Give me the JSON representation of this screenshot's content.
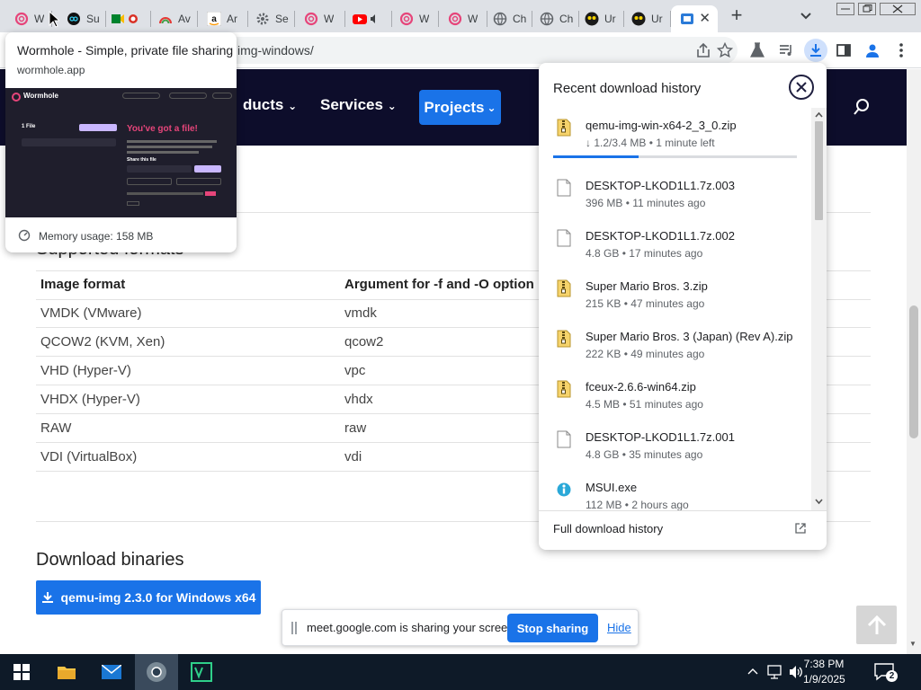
{
  "tabs": [
    {
      "title": "W",
      "icon": "wormhole-icon"
    },
    {
      "title": "Su",
      "icon": "app-icon"
    },
    {
      "title": "",
      "icon": "meet-icon"
    },
    {
      "title": "Av",
      "icon": "rainbow-icon"
    },
    {
      "title": "Ar",
      "icon": "amazon-icon"
    },
    {
      "title": "Se",
      "icon": "gear-icon"
    },
    {
      "title": "W",
      "icon": "wormhole-icon"
    },
    {
      "title": "",
      "icon": "youtube-icon"
    },
    {
      "title": "W",
      "icon": "wormhole-icon"
    },
    {
      "title": "W",
      "icon": "wormhole-icon"
    },
    {
      "title": "Ch",
      "icon": "globe-icon"
    },
    {
      "title": "Ch",
      "icon": "globe-icon"
    },
    {
      "title": "Ur",
      "icon": "owl-icon"
    },
    {
      "title": "Ur",
      "icon": "owl-icon"
    }
  ],
  "active_tab": {
    "icon": "qemu-icon",
    "close": "✕"
  },
  "new_tab": "+",
  "address": {
    "text": "img-windows/"
  },
  "site_nav": {
    "products": "ducts",
    "services": "Services",
    "projects": "Projects"
  },
  "page": {
    "formats_heading": "Supported formats",
    "table": {
      "headers": [
        "Image format",
        "Argument for -f and -O option"
      ],
      "rows": [
        [
          "VMDK (VMware)",
          "vmdk"
        ],
        [
          "QCOW2 (KVM, Xen)",
          "qcow2"
        ],
        [
          "VHD (Hyper-V)",
          "vpc"
        ],
        [
          "VHDX (Hyper-V)",
          "vhdx"
        ],
        [
          "RAW",
          "raw"
        ],
        [
          "VDI (VirtualBox)",
          "vdi"
        ]
      ]
    },
    "download_heading": "Download binaries",
    "download_button": "qemu-img 2.3.0 for Windows x64"
  },
  "hover_card": {
    "title": "Wormhole - Simple, private file sharing",
    "domain": "wormhole.app",
    "memory": "Memory usage: 158 MB",
    "preview": {
      "brand": "Wormhole",
      "headline": "You've got a file!",
      "files": "1 File",
      "share": "Share this file"
    }
  },
  "downloads": {
    "title": "Recent download history",
    "items": [
      {
        "name": "qemu-img-win-x64-2_3_0.zip",
        "meta": "↓ 1.2/3.4 MB • 1 minute left",
        "kind": "zip",
        "progress": 0.35
      },
      {
        "name": "DESKTOP-LKOD1L1.7z.003",
        "meta": "396 MB • 11 minutes ago",
        "kind": "file"
      },
      {
        "name": "DESKTOP-LKOD1L1.7z.002",
        "meta": "4.8 GB • 17 minutes ago",
        "kind": "file"
      },
      {
        "name": "Super Mario Bros. 3.zip",
        "meta": "215 KB • 47 minutes ago",
        "kind": "zip"
      },
      {
        "name": "Super Mario Bros. 3 (Japan) (Rev A).zip",
        "meta": "222 KB • 49 minutes ago",
        "kind": "zip"
      },
      {
        "name": "fceux-2.6.6-win64.zip",
        "meta": "4.5 MB • 51 minutes ago",
        "kind": "zip"
      },
      {
        "name": "DESKTOP-LKOD1L1.7z.001",
        "meta": "4.8 GB • 35 minutes ago",
        "kind": "file"
      },
      {
        "name": "MSUI.exe",
        "meta": "112 MB • 2 hours ago",
        "kind": "exe"
      }
    ],
    "footer": "Full download history"
  },
  "share_bar": {
    "text": "meet.google.com is sharing your screen.",
    "stop": "Stop sharing",
    "hide": "Hide"
  },
  "taskbar": {
    "time": "7:38 PM",
    "date": "1/9/2025",
    "notifications": "2"
  },
  "colors": {
    "accent": "#1a73e8",
    "site_nav_bg": "#0d0d2b",
    "taskbar_bg": "#0e1a28",
    "wormhole_pink": "#e6457a"
  }
}
